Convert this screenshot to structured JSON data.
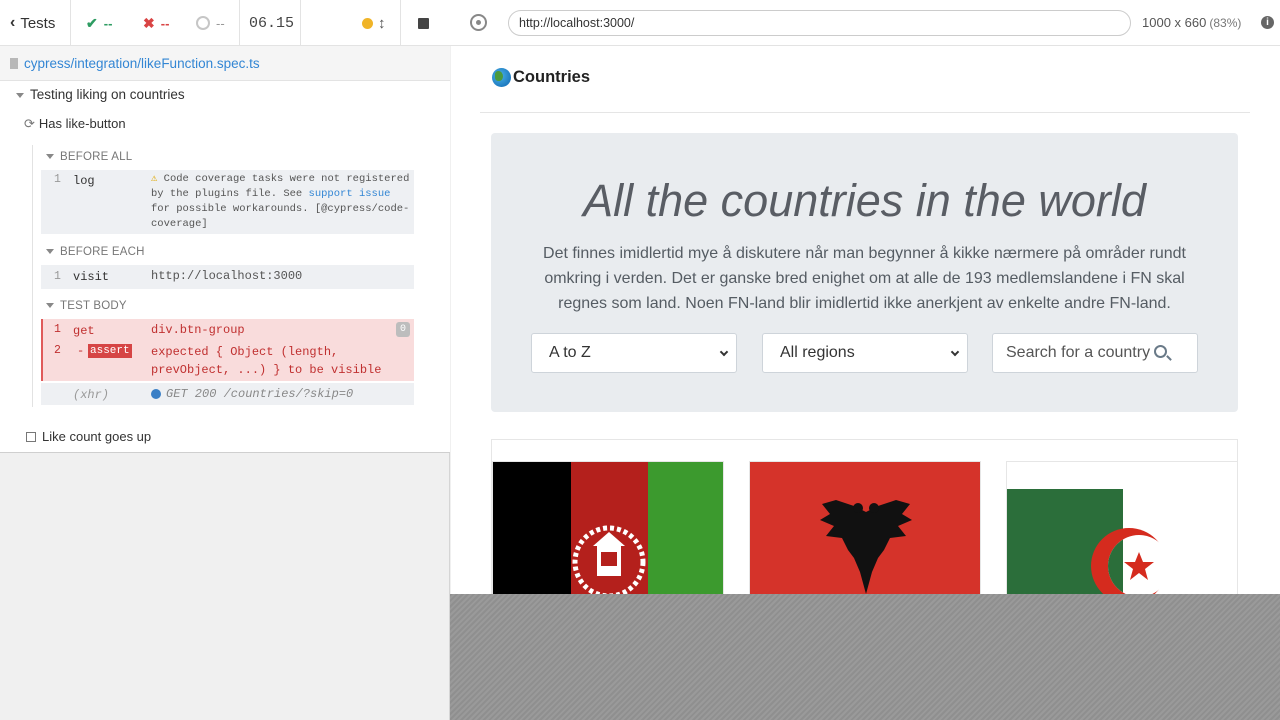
{
  "reporter": {
    "stats": {
      "tests_label": "Tests",
      "passed": "--",
      "failed": "--",
      "pending": "--",
      "duration": "06.15"
    },
    "spec_path": "cypress/integration/likeFunction.spec.ts",
    "suite_title": "Testing liking on countries",
    "tests": [
      {
        "title": "Has like-button",
        "state": "running"
      },
      {
        "title": "Like count goes up",
        "state": "pending"
      }
    ],
    "hooks": {
      "before_all": {
        "title": "BEFORE ALL",
        "commands": [
          {
            "num": "1",
            "name": "log",
            "message_prefix": "Code coverage tasks were not registered by the plugins file. See ",
            "link1": "support",
            "link2": "issue",
            "message_suffix": " for possible workarounds. [@cypress/code-coverage]"
          }
        ]
      },
      "before_each": {
        "title": "BEFORE EACH",
        "commands": [
          {
            "num": "1",
            "name": "visit",
            "message": "http://localhost:3000"
          }
        ]
      },
      "test_body": {
        "title": "TEST BODY",
        "commands": [
          {
            "num": "1",
            "name": "get",
            "message": "div.btn-group",
            "badge": "0"
          },
          {
            "num": "2",
            "name": "-assert",
            "message_line1": "expected { Object (length,",
            "message_line2": "prevObject, ...) } to be visible"
          },
          {
            "num": "",
            "name": "(xhr)",
            "message": "GET 200 /countries/?skip=0"
          }
        ]
      }
    }
  },
  "aut": {
    "url": "http://localhost:3000/",
    "viewport": "1000 x 660",
    "scale": "(83%)",
    "app": {
      "brand": "Countries",
      "hero_title": "All the countries in the world",
      "hero_text": "Det finnes imidlertid mye å diskutere når man begynner å kikke nærmere på områder rundt omkring i verden. Det er ganske bred enighet om at alle de 193 medlemslandene i FN skal regnes som land. Noen FN-land blir imidlertid ikke anerkjent av enkelte andre FN-land.",
      "sort_selected": "A to Z",
      "region_selected": "All regions",
      "search_placeholder": "Search for a country"
    }
  },
  "colors": {
    "passed": "#2e9c62",
    "failed": "#d94444",
    "link": "#3386d4",
    "running": "#f0b428"
  }
}
